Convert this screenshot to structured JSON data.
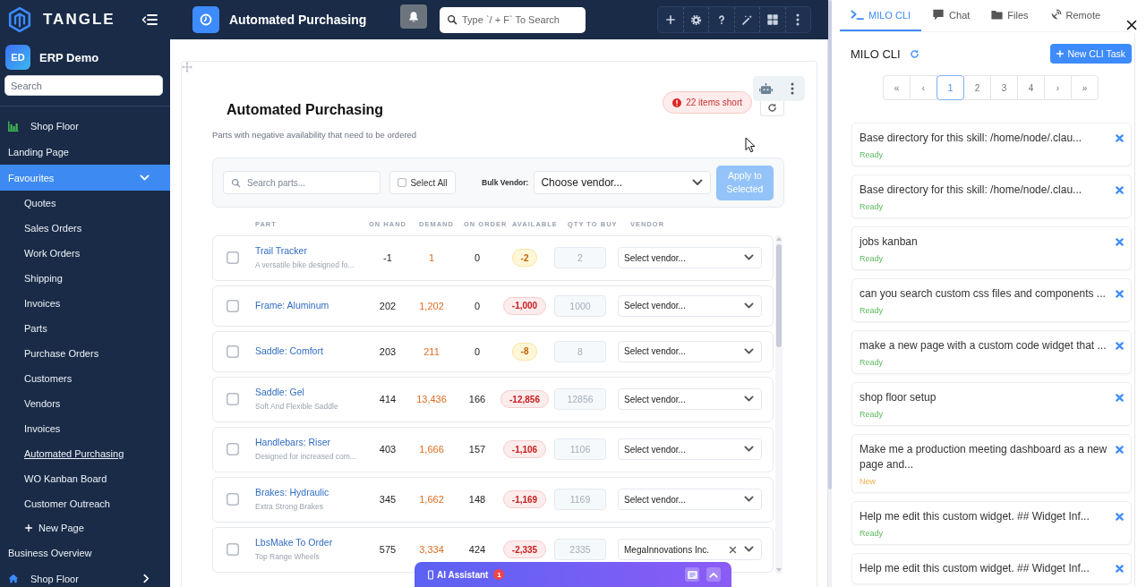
{
  "topbar": {
    "brand": "TANGLE",
    "page_title": "Automated Purchasing",
    "search": {
      "placeholder": "Type `/ + F` To Search"
    }
  },
  "sidebar": {
    "workspace": {
      "initials": "ED",
      "name": "ERP Demo"
    },
    "search": {
      "placeholder": "Search"
    },
    "items": [
      {
        "label": "Shop Floor",
        "kind": "link",
        "selected": false
      },
      {
        "label": "Landing Page",
        "kind": "link",
        "selected": false
      },
      {
        "label": "Favourites",
        "kind": "group",
        "selected": true,
        "expanded": true,
        "children": [
          {
            "label": "Quotes",
            "kind": "link",
            "selected": false
          },
          {
            "label": "Sales Orders",
            "kind": "link",
            "selected": false
          },
          {
            "label": "Work Orders",
            "kind": "link",
            "selected": false
          },
          {
            "label": "Shipping",
            "kind": "link",
            "selected": false
          },
          {
            "label": "Invoices",
            "kind": "link",
            "selected": false
          },
          {
            "label": "Parts",
            "kind": "link",
            "selected": false
          },
          {
            "label": "Purchase Orders",
            "kind": "link",
            "selected": false
          },
          {
            "label": "Customers",
            "kind": "link",
            "selected": false
          },
          {
            "label": "Vendors",
            "kind": "link",
            "selected": false
          },
          {
            "label": "Invoices",
            "kind": "link",
            "selected": false
          },
          {
            "label": "Automated Purchasing",
            "kind": "link",
            "selected": true
          },
          {
            "label": "WO Kanban Board",
            "kind": "link",
            "selected": false
          },
          {
            "label": "Customer Outreach",
            "kind": "link",
            "selected": false
          },
          {
            "label": "New Page",
            "kind": "add",
            "selected": false
          }
        ]
      },
      {
        "label": "Business Overview",
        "kind": "link",
        "selected": false
      },
      {
        "label": "Shop Floor",
        "kind": "group",
        "selected": false,
        "expanded": false
      }
    ]
  },
  "widget": {
    "title": "Automated Purchasing",
    "subtitle": "Parts with negative availability that need to be ordered",
    "shortage_badge": "22 items short",
    "filters": {
      "search": {
        "placeholder": "Search parts..."
      },
      "select_all": {
        "label": "Select All",
        "checked": false
      },
      "bulk_vendor_label": "Bulk Vendor:",
      "bulk_vendor": "Choose vendor...",
      "apply_button": {
        "label": "Apply to Selected",
        "disabled": true
      }
    },
    "table": {
      "columns": [
        "PART",
        "ON HAND",
        "DEMAND",
        "ON ORDER",
        "AVAILABLE",
        "QTY TO BUY",
        "VENDOR"
      ],
      "rows": [
        {
          "checked": false,
          "name": "Trail Tracker",
          "description": "A versatile bike designed fo...",
          "on_hand": "-1",
          "demand": "1",
          "on_order": "0",
          "available": "-2",
          "critical": false,
          "qty_to_buy": {
            "placeholder": "2"
          },
          "vendor": {
            "value": "Select vendor...",
            "chosen": false
          }
        },
        {
          "checked": false,
          "name": "Frame: Aluminum",
          "on_hand": "202",
          "demand": "1,202",
          "on_order": "0",
          "available": "-1,000",
          "critical": true,
          "qty_to_buy": {
            "placeholder": "1000"
          },
          "vendor": {
            "value": "Select vendor...",
            "chosen": false
          }
        },
        {
          "checked": false,
          "name": "Saddle: Comfort",
          "on_hand": "203",
          "demand": "211",
          "on_order": "0",
          "available": "-8",
          "critical": false,
          "qty_to_buy": {
            "placeholder": "8"
          },
          "vendor": {
            "value": "Select vendor...",
            "chosen": false
          }
        },
        {
          "checked": false,
          "name": "Saddle: Gel",
          "description": "Soft And Flexible Saddle",
          "on_hand": "414",
          "demand": "13,436",
          "on_order": "166",
          "available": "-12,856",
          "critical": true,
          "qty_to_buy": {
            "placeholder": "12856"
          },
          "vendor": {
            "value": "Select vendor...",
            "chosen": false
          }
        },
        {
          "checked": false,
          "name": "Handlebars: Riser",
          "description": "Designed for increased com...",
          "on_hand": "403",
          "demand": "1,666",
          "on_order": "157",
          "available": "-1,106",
          "critical": true,
          "qty_to_buy": {
            "placeholder": "1106"
          },
          "vendor": {
            "value": "Select vendor...",
            "chosen": false
          }
        },
        {
          "checked": false,
          "name": "Brakes: Hydraulic",
          "description": "Extra Strong Brakes",
          "on_hand": "345",
          "demand": "1,662",
          "on_order": "148",
          "available": "-1,169",
          "critical": true,
          "qty_to_buy": {
            "placeholder": "1169"
          },
          "vendor": {
            "value": "Select vendor...",
            "chosen": false
          }
        },
        {
          "checked": false,
          "name": "LbsMake To Order",
          "description": "Top Range Wheels",
          "on_hand": "575",
          "demand": "3,334",
          "on_order": "424",
          "available": "-2,335",
          "critical": true,
          "qty_to_buy": {
            "placeholder": "2335"
          },
          "vendor": {
            "value": "MegaInnovations Inc.",
            "chosen": true
          }
        }
      ]
    }
  },
  "ai_assistant": {
    "label": "AI Assistant",
    "badge": "1"
  },
  "side_panel": {
    "tabs": [
      {
        "label": "MILO CLI",
        "selected": true
      },
      {
        "label": "Chat",
        "selected": false
      },
      {
        "label": "Files",
        "selected": false
      },
      {
        "label": "Remote",
        "selected": false
      }
    ],
    "heading": "MILO CLI",
    "new_task_button": "New CLI Task",
    "pagination": [
      {
        "label": "«",
        "selected": false
      },
      {
        "label": "‹",
        "selected": false
      },
      {
        "label": "1",
        "selected": true
      },
      {
        "label": "2",
        "selected": false
      },
      {
        "label": "3",
        "selected": false
      },
      {
        "label": "4",
        "selected": false
      },
      {
        "label": "›",
        "selected": false
      },
      {
        "label": "»",
        "selected": false
      }
    ],
    "tasks": [
      {
        "title": "Base directory for this skill: /home/node/.clau...",
        "status": "Ready",
        "kind": "ready"
      },
      {
        "title": "Base directory for this skill: /home/node/.clau...",
        "status": "Ready",
        "kind": "ready"
      },
      {
        "title": "jobs kanban",
        "status": "Ready",
        "kind": "ready"
      },
      {
        "title": "can you search custom css files and components ...",
        "status": "Ready",
        "kind": "ready"
      },
      {
        "title": "make a new page with a custom code widget that ...",
        "status": "Ready",
        "kind": "ready"
      },
      {
        "title": "shop floor setup",
        "status": "Ready",
        "kind": "ready"
      },
      {
        "title": "Make me a production meeting dashboard as a new page and...",
        "status": "New",
        "kind": "new"
      },
      {
        "title": "Help me edit this custom widget. ## Widget Inf...",
        "status": "Ready",
        "kind": "ready"
      },
      {
        "title": "Help me edit this custom widget. ## Widget Inf..."
      }
    ]
  }
}
